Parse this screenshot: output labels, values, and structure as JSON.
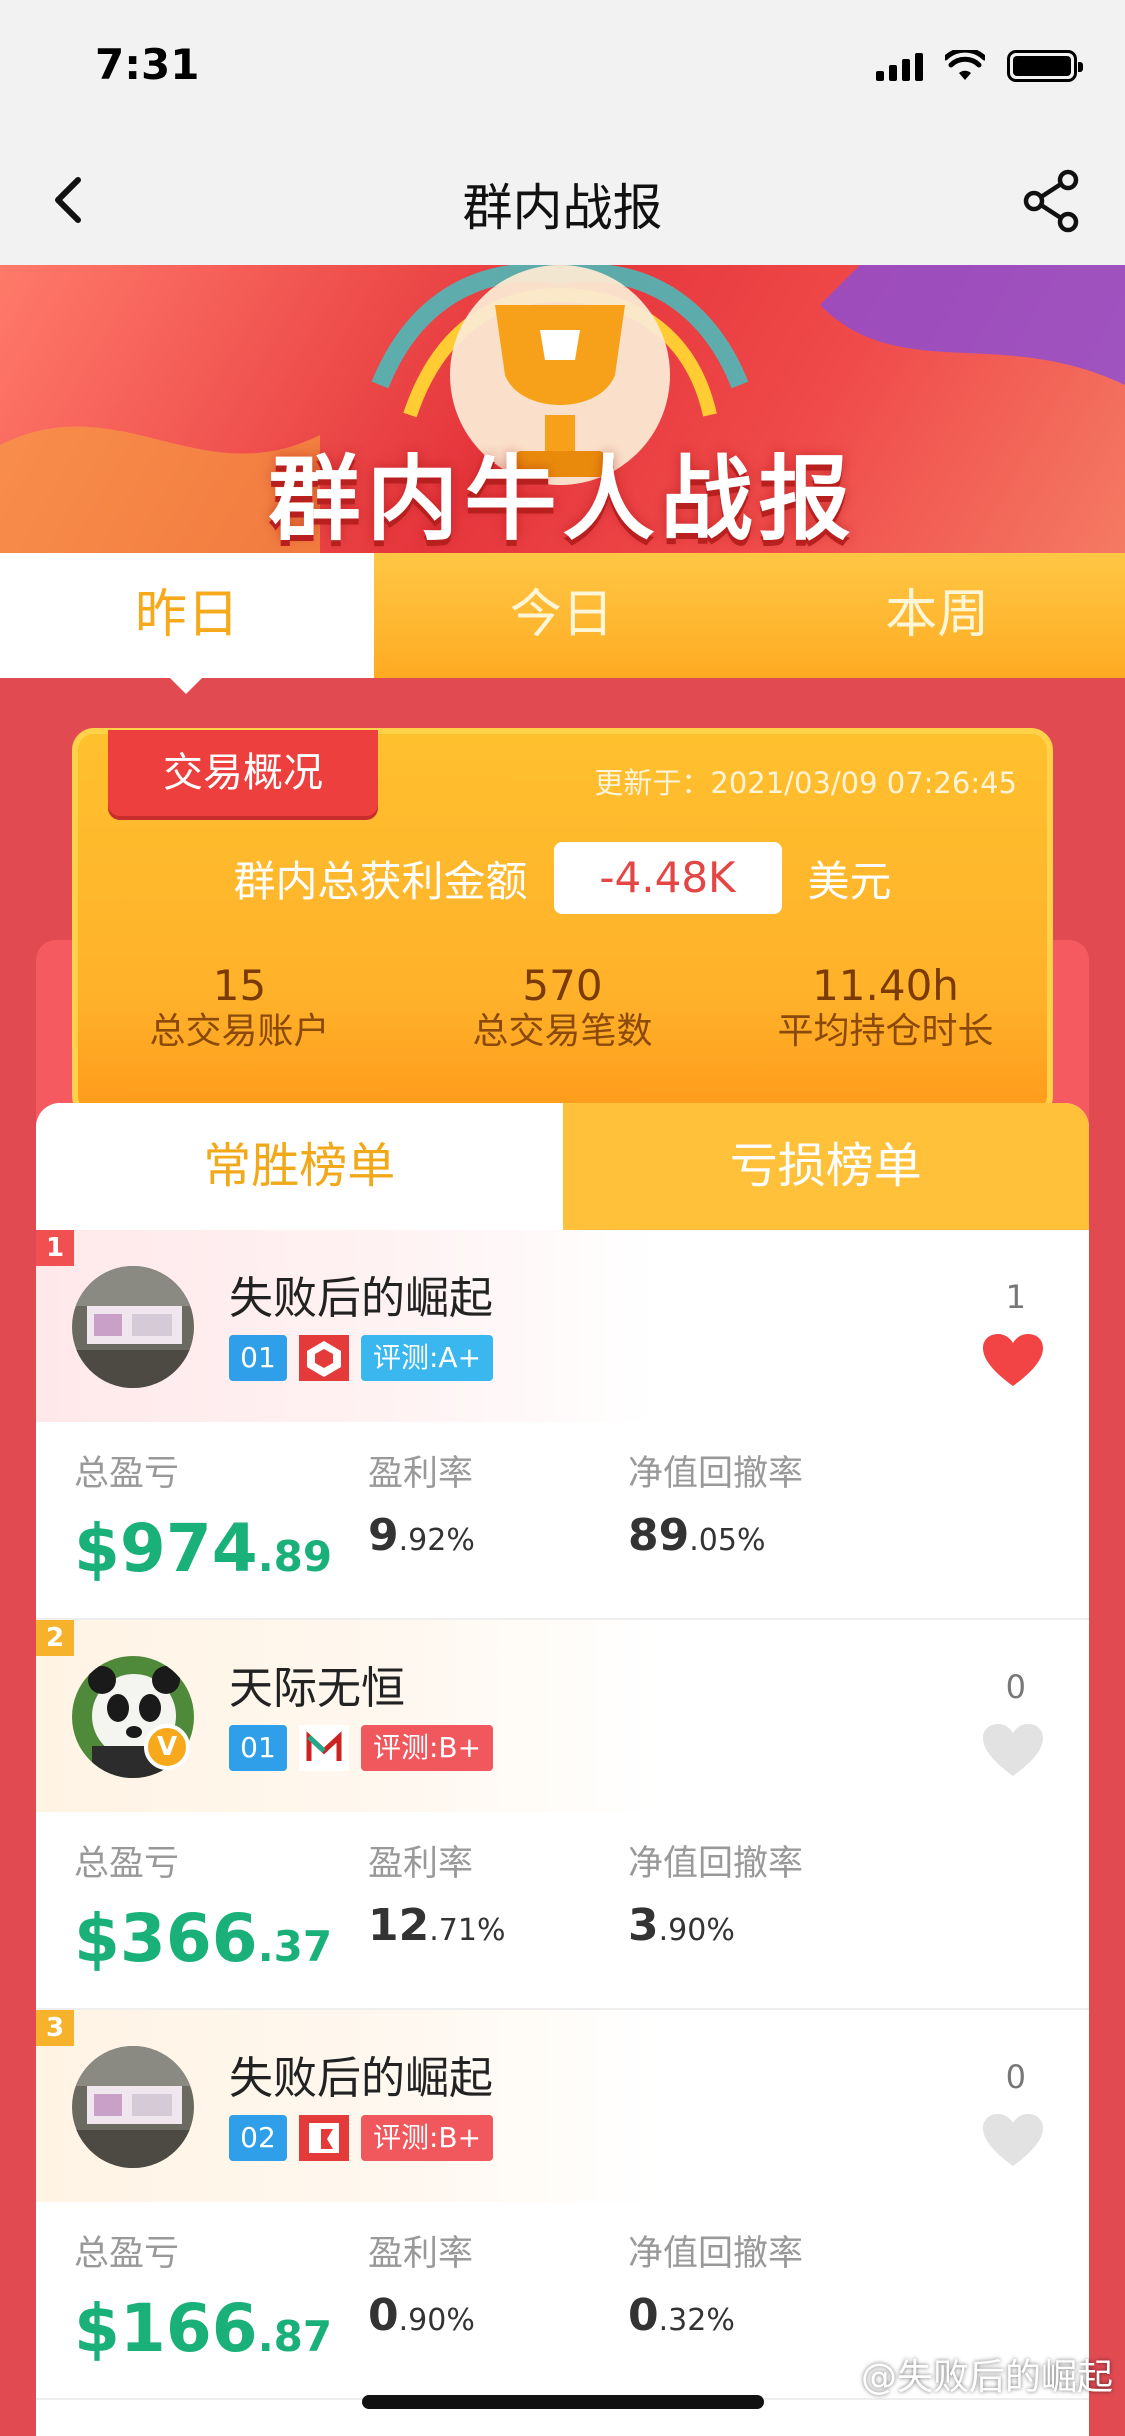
{
  "status_bar": {
    "time": "7:31"
  },
  "nav": {
    "title": "群内战报"
  },
  "banner": {
    "title": "群内牛人战报"
  },
  "period_tabs": [
    {
      "label": "昨日",
      "active": true
    },
    {
      "label": "今日",
      "active": false
    },
    {
      "label": "本周",
      "active": false
    }
  ],
  "summary": {
    "tag": "交易概况",
    "updated": "更新于：2021/03/09 07:26:45",
    "profit_label": "群内总获利金额",
    "profit_value": "-4.48K",
    "profit_unit": "美元",
    "stats": [
      {
        "value": "15",
        "label": "总交易账户"
      },
      {
        "value": "570",
        "label": "总交易笔数"
      },
      {
        "value": "11.40h",
        "label": "平均持仓时长"
      }
    ]
  },
  "rank_tabs": [
    {
      "label": "常胜榜单",
      "active": true
    },
    {
      "label": "亏损榜单",
      "active": false
    }
  ],
  "metric_labels": {
    "total": "总盈亏",
    "rate": "盈利率",
    "drawdown": "净值回撤率"
  },
  "entries": [
    {
      "rank": "1",
      "name": "失败后的崛起",
      "account": "01",
      "rating": "评测:A+",
      "rating_color": "#3ab7ef",
      "likes": "1",
      "liked": true,
      "total_main": "$974",
      "total_dec": ".89",
      "rate_main": "9",
      "rate_dec": ".92%",
      "dd_main": "89",
      "dd_dec": ".05%"
    },
    {
      "rank": "2",
      "name": "天际无恒",
      "account": "01",
      "rating": "评测:B+",
      "rating_color": "#f0585d",
      "likes": "0",
      "liked": false,
      "total_main": "$366",
      "total_dec": ".37",
      "rate_main": "12",
      "rate_dec": ".71%",
      "dd_main": "3",
      "dd_dec": ".90%"
    },
    {
      "rank": "3",
      "name": "失败后的崛起",
      "account": "02",
      "rating": "评测:B+",
      "rating_color": "#f0585d",
      "likes": "0",
      "liked": false,
      "total_main": "$166",
      "total_dec": ".87",
      "rate_main": "0",
      "rate_dec": ".90%",
      "dd_main": "0",
      "dd_dec": ".32%"
    }
  ],
  "watermark": "@失败后的崛起",
  "colors": {
    "accent_orange": "#f7a91b",
    "profit_green": "#1ab07a",
    "brand_red": "#e24a52"
  }
}
